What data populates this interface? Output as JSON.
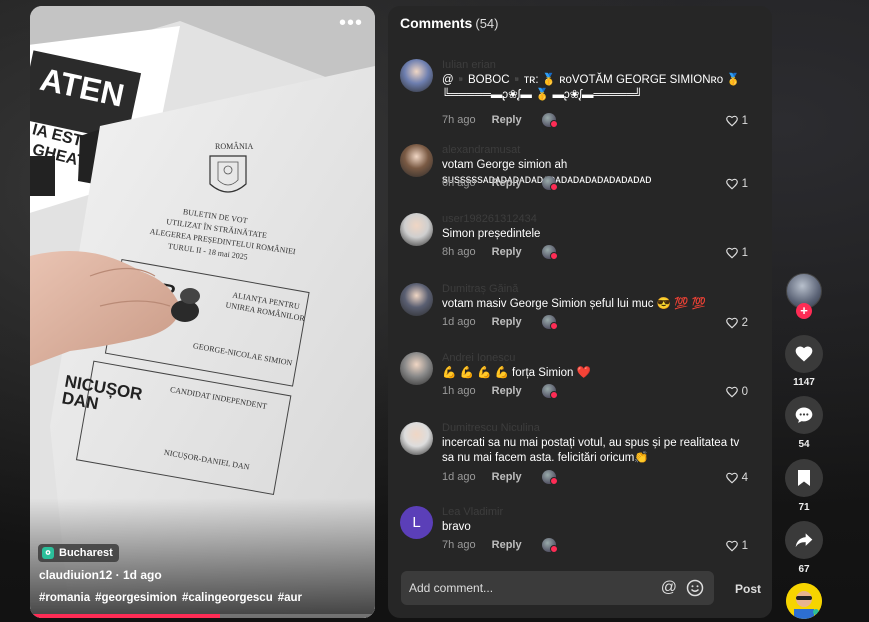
{
  "video": {
    "location": "Bucharest",
    "author_line": "claudiuion12 · 1d ago",
    "hashtags": [
      "#romania",
      "#georgesimion",
      "#calingeorgescu",
      "#aur"
    ],
    "progress_fraction": 0.55,
    "ballot_text": {
      "country": "ROMÂNIA",
      "line1": "BULETIN DE VOT",
      "line2": "UTILIZAT ÎN STRĂINĂTATE",
      "line3": "ALEGEREA PREȘEDINTELUI ROMÂNIEI",
      "line4": "TURUL II - 18 mai 2025",
      "party1_a": "ALIANȚA PENTRU",
      "party1_b": "UNIREA ROMÂNILOR",
      "party1_logo": "AUR",
      "cand1": "GEORGE-NICOLAE SIMION",
      "cand2_label": "CANDIDAT INDEPENDENT",
      "cand2_logo_a": "NICUȘOR",
      "cand2_logo_b": "DAN",
      "cand2": "NICUȘOR-DANIEL DAN",
      "poster_a": "ATEN",
      "poster_b": "IA ESTE",
      "poster_c": "GHEATĂ"
    }
  },
  "comments_panel": {
    "title": "Comments",
    "count": "(54)",
    "reply_label": "Reply",
    "add_placeholder": "Add comment...",
    "at_symbol": "@",
    "post_label": "Post",
    "items": [
      {
        "name": "Iulian erian",
        "text_line1": "@▪️BOBOC▪️ᴛʀ: 🥇 ʀᴏVOTĂM GEORGE SIMIONʀᴏ 🥇",
        "text_line2": "╚═════▬ᶗ❀ᶘ▬ 🥇 ▬ᶗ❀ᶘ▬═════╝",
        "time": "7h ago",
        "likes": "1",
        "avatar_color": "#6e7fb0"
      },
      {
        "name": "alexandramusat",
        "text_line1": "votam George simion ah susssssᴀᴅᴀᴅᴀᴅᴀᴅᴀᴅᴀᴅᴀᴅᴀᴅᴀᴅᴀᴅᴀᴅᴀᴅᴀᴅᴀᴅ",
        "text_line2": "",
        "time": "6h ago",
        "likes": "1",
        "avatar_color": "#7a5a44"
      },
      {
        "name": "user198261312434",
        "text_line1": "Simon președintele",
        "text_line2": "",
        "time": "8h ago",
        "likes": "1",
        "avatar_color": "#cfcfcf"
      },
      {
        "name": "Dumitraș Găină",
        "text_line1": "votam masiv George Simion șeful lui muc 😎 💯 💯",
        "text_line2": "",
        "time": "1d ago",
        "likes": "2",
        "avatar_color": "#5a5f72"
      },
      {
        "name": "Andrei Ionescu",
        "text_line1": "💪 💪 💪 💪  forța Simion ❤️",
        "text_line2": "",
        "time": "1h ago",
        "likes": "0",
        "avatar_color": "#8a8a8a"
      },
      {
        "name": "Dumitrescu Niculina",
        "text_line1": "incercati sa nu mai postați votul, au spus și pe realitatea tv",
        "text_line2": "sa nu mai facem asta. felicitări oricum👏",
        "time": "1d ago",
        "likes": "4",
        "avatar_color": "#dddddd"
      },
      {
        "name": "Lea Vladimir",
        "text_line1": "bravo",
        "text_line2": "",
        "time": "7h ago",
        "likes": "1",
        "avatar_color": "#5b3fb8",
        "avatar_letter": "L"
      }
    ]
  },
  "rail": {
    "likes": "1147",
    "comments": "54",
    "saves": "71",
    "shares": "67",
    "follow_symbol": "+"
  }
}
